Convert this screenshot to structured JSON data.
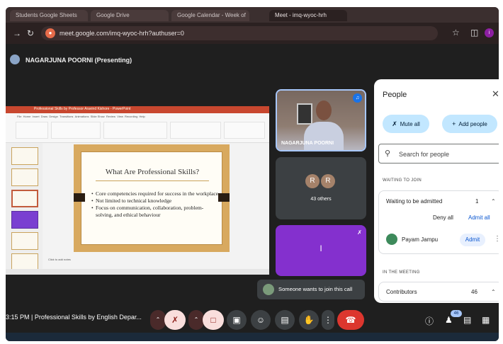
{
  "browser": {
    "tabs": [
      "Students Google Sheets",
      "Google Drive",
      "Google Calendar - Week of",
      "Meet - imq-wyoc-hrh"
    ],
    "url": "meet.google.com/imq-wyoc-hrh?authuser=0",
    "profile_initial": "i"
  },
  "meet": {
    "presenting_label": "NAGARJUNA POORNI (Presenting)",
    "slide": {
      "window_title": "Professional Skills by Professor Aravind Kishore - PowerPoint",
      "title": "What Are Professional Skills?",
      "bullets": [
        "Core competencies required for success in the workplace",
        "Not limited to technical knowledge",
        "Focus on communication, collaboration, problem-solving, and ethical behaviour"
      ],
      "notes_hint": "Click to add notes"
    },
    "tiles": {
      "speaker_name": "NAGARJUNA POORNI",
      "others_initials": [
        "R",
        "R"
      ],
      "others_label": "43 others",
      "purple_letter": "I"
    },
    "toast": "Someone wants to join this call",
    "bottom": {
      "time_title": "3:15 PM  |  Professional Skills by English Depar...",
      "people_count_badge": "46"
    }
  },
  "people_panel": {
    "title": "People",
    "mute_all": "Mute all",
    "add_people": "Add people",
    "search_placeholder": "Search for people",
    "waiting_section": "WAITING TO JOIN",
    "waiting_header": "Waiting to be admitted",
    "waiting_count": "1",
    "deny_all": "Deny all",
    "admit_all": "Admit all",
    "waiting_user": "Payam Jampu",
    "admit": "Admit",
    "meeting_section": "IN THE MEETING",
    "contributors": "Contributors",
    "contributors_count": "46"
  },
  "colors": {
    "accent": "#0b57d0",
    "end_call": "#dc362e",
    "pill": "#c2e7ff"
  }
}
